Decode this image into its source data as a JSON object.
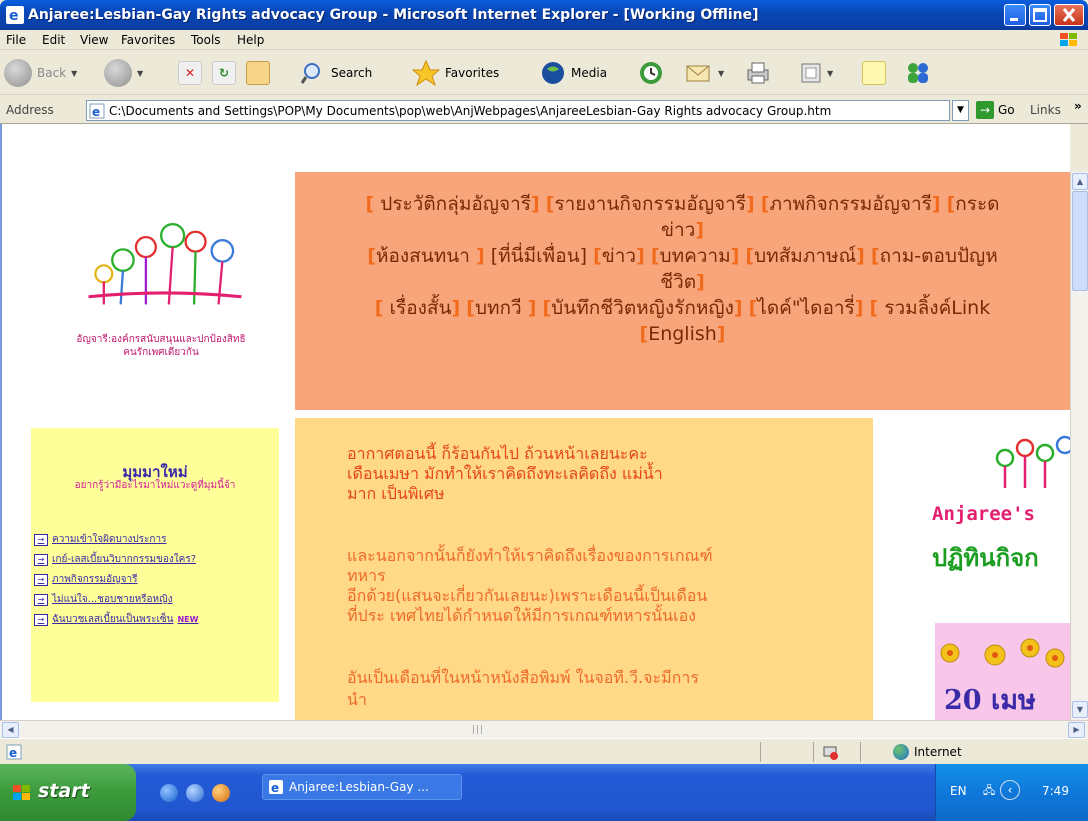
{
  "window": {
    "title": "Anjaree:Lesbian-Gay Rights advocacy Group - Microsoft Internet Explorer - [Working Offline]"
  },
  "menu": [
    "File",
    "Edit",
    "View",
    "Favorites",
    "Tools",
    "Help"
  ],
  "toolbar": {
    "back": "Back",
    "search": "Search",
    "favorites": "Favorites",
    "media": "Media"
  },
  "address": {
    "label": "Address",
    "url": "C:\\Documents and Settings\\POP\\My Documents\\pop\\web\\AnjWebpages\\AnjareeLesbian-Gay Rights advocacy Group.htm",
    "go": "Go",
    "links": "Links"
  },
  "page": {
    "logo_caption_1": "อัญจารี:องค์กรสนับสนุนและปกป้องสิทธิ",
    "logo_caption_2": "คนรักเพศเดียวกัน",
    "nav": {
      "row1": [
        "ประวัติกลุ่มอัญจารี",
        "รายงานกิจกรรมอัญจารี",
        "ภาพกิจกรรมอัญจารี",
        "กระด"
      ],
      "row1b": "ข่าว",
      "row2": [
        "ห้องสนทนา ",
        "ที่นี่มีเพื่อน",
        "ข่าว",
        "บทความ",
        "บทสัมภาษณ์",
        "ถาม-ตอบปัญห"
      ],
      "row2b": "ชีวิต",
      "row3": [
        "เรื่องสั้น",
        "บทกวี ",
        "บันทึกชีวิตหญิงรักหญิง",
        "ไดค์\"ไดอารี่",
        " รวมลิ้งค์Link"
      ],
      "row3b": "English"
    },
    "sidebar": {
      "title": "มุมมาใหม่",
      "subtitle": "อยากรู้ว่ามีอะไรมาใหม่แวะดูที่มุมนี้จ้า",
      "links": [
        "ความเข้าใจผิดบางประการ",
        "เกย์-เลสเบี้ยนวิบากกรรมของใคร?",
        "ภาพกิจกรรมอัญจารี",
        "ไม่แน่ใจ...ชอบชายหรือหญิง",
        "ฉันบวชเลสเบี้ยนเป็นพระเซ็น"
      ],
      "new_badge": "NEW"
    },
    "article": {
      "p1": [
        "อากาศตอนนี้ ก็ร้อนกันไป ถ้วนหน้าเลยนะคะ",
        "เดือนเมษา มักทำให้เราคิดถึงทะเลคิดถึง แม่น้ำ",
        "มาก เป็นพิเศษ"
      ],
      "p2": [
        "และนอกจากนั้นก็ยังทำให้เราคิดถึงเรื่องของการเกณฑ์",
        "ทหาร",
        "อีกด้วย(แสนจะเกี่ยวกันเลยนะ)เพราะเดือนนี้เป็นเดือน",
        "ที่ประ เทศไทยได้กำหนดให้มีการเกณฑ์ทหารนั้นเอง"
      ],
      "p3": [
        "อันเป็นเดือนที่ในหน้าหนังสือพิมพ์ ในจอที.วี.จะมีการ",
        "นำ"
      ]
    },
    "right": {
      "anjaree": "Anjaree's",
      "calendar": "ปฏิทินกิจก",
      "date": "20 เมษ"
    }
  },
  "status": {
    "zone": "Internet"
  },
  "taskbar": {
    "start": "start",
    "task": "Anjaree:Lesbian-Gay ...",
    "lang": "EN",
    "time": "7:49"
  }
}
